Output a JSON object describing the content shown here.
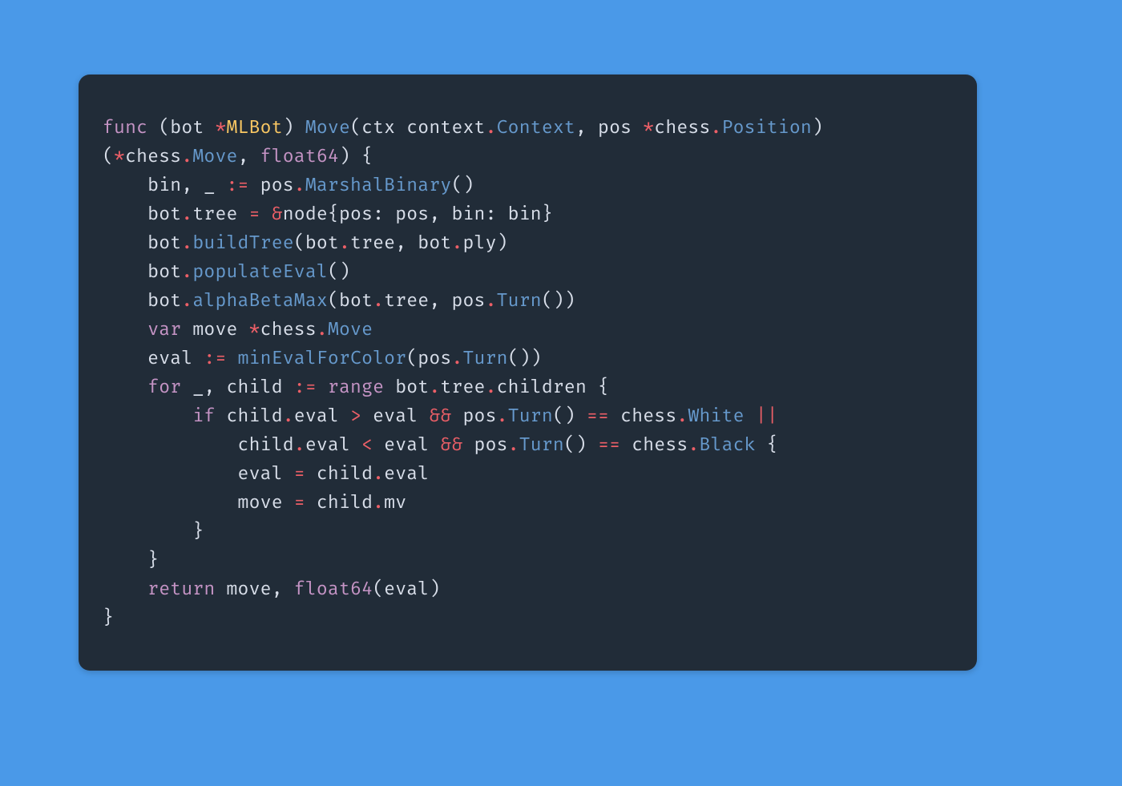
{
  "language": "go",
  "code": {
    "lines": [
      [
        {
          "t": "func",
          "c": "kw"
        },
        {
          "t": " (bot ",
          "c": "id"
        },
        {
          "t": "*",
          "c": "op"
        },
        {
          "t": "MLBot",
          "c": "ty"
        },
        {
          "t": ") ",
          "c": "id"
        },
        {
          "t": "Move",
          "c": "fn"
        },
        {
          "t": "(ctx context",
          "c": "id"
        },
        {
          "t": ".",
          "c": "op"
        },
        {
          "t": "Context",
          "c": "fn"
        },
        {
          "t": ", pos ",
          "c": "id"
        },
        {
          "t": "*",
          "c": "op"
        },
        {
          "t": "chess",
          "c": "id"
        },
        {
          "t": ".",
          "c": "op"
        },
        {
          "t": "Position",
          "c": "fn"
        },
        {
          "t": ") ",
          "c": "id"
        }
      ],
      [
        {
          "t": "(",
          "c": "id"
        },
        {
          "t": "*",
          "c": "op"
        },
        {
          "t": "chess",
          "c": "id"
        },
        {
          "t": ".",
          "c": "op"
        },
        {
          "t": "Move",
          "c": "fn"
        },
        {
          "t": ", ",
          "c": "id"
        },
        {
          "t": "float64",
          "c": "kw"
        },
        {
          "t": ") {",
          "c": "id"
        }
      ],
      [
        {
          "t": "    bin, _ ",
          "c": "id"
        },
        {
          "t": ":=",
          "c": "op"
        },
        {
          "t": " pos",
          "c": "id"
        },
        {
          "t": ".",
          "c": "op"
        },
        {
          "t": "MarshalBinary",
          "c": "fn"
        },
        {
          "t": "()",
          "c": "id"
        }
      ],
      [
        {
          "t": "    bot",
          "c": "id"
        },
        {
          "t": ".",
          "c": "op"
        },
        {
          "t": "tree ",
          "c": "id"
        },
        {
          "t": "=",
          "c": "op"
        },
        {
          "t": " ",
          "c": "id"
        },
        {
          "t": "&",
          "c": "am"
        },
        {
          "t": "node{pos: pos, bin: bin}",
          "c": "id"
        }
      ],
      [
        {
          "t": "    bot",
          "c": "id"
        },
        {
          "t": ".",
          "c": "op"
        },
        {
          "t": "buildTree",
          "c": "fn"
        },
        {
          "t": "(bot",
          "c": "id"
        },
        {
          "t": ".",
          "c": "op"
        },
        {
          "t": "tree, bot",
          "c": "id"
        },
        {
          "t": ".",
          "c": "op"
        },
        {
          "t": "ply)",
          "c": "id"
        }
      ],
      [
        {
          "t": "    bot",
          "c": "id"
        },
        {
          "t": ".",
          "c": "op"
        },
        {
          "t": "populateEval",
          "c": "fn"
        },
        {
          "t": "()",
          "c": "id"
        }
      ],
      [
        {
          "t": "    bot",
          "c": "id"
        },
        {
          "t": ".",
          "c": "op"
        },
        {
          "t": "alphaBetaMax",
          "c": "fn"
        },
        {
          "t": "(bot",
          "c": "id"
        },
        {
          "t": ".",
          "c": "op"
        },
        {
          "t": "tree, pos",
          "c": "id"
        },
        {
          "t": ".",
          "c": "op"
        },
        {
          "t": "Turn",
          "c": "fn"
        },
        {
          "t": "())",
          "c": "id"
        }
      ],
      [
        {
          "t": "    ",
          "c": "id"
        },
        {
          "t": "var",
          "c": "kw"
        },
        {
          "t": " move ",
          "c": "id"
        },
        {
          "t": "*",
          "c": "op"
        },
        {
          "t": "chess",
          "c": "id"
        },
        {
          "t": ".",
          "c": "op"
        },
        {
          "t": "Move",
          "c": "fn"
        }
      ],
      [
        {
          "t": "    eval ",
          "c": "id"
        },
        {
          "t": ":=",
          "c": "op"
        },
        {
          "t": " ",
          "c": "id"
        },
        {
          "t": "minEvalForColor",
          "c": "fn"
        },
        {
          "t": "(pos",
          "c": "id"
        },
        {
          "t": ".",
          "c": "op"
        },
        {
          "t": "Turn",
          "c": "fn"
        },
        {
          "t": "())",
          "c": "id"
        }
      ],
      [
        {
          "t": "    ",
          "c": "id"
        },
        {
          "t": "for",
          "c": "kw"
        },
        {
          "t": " _, child ",
          "c": "id"
        },
        {
          "t": ":=",
          "c": "op"
        },
        {
          "t": " ",
          "c": "id"
        },
        {
          "t": "range",
          "c": "kw"
        },
        {
          "t": " bot",
          "c": "id"
        },
        {
          "t": ".",
          "c": "op"
        },
        {
          "t": "tree",
          "c": "id"
        },
        {
          "t": ".",
          "c": "op"
        },
        {
          "t": "children {",
          "c": "id"
        }
      ],
      [
        {
          "t": "        ",
          "c": "id"
        },
        {
          "t": "if",
          "c": "kw"
        },
        {
          "t": " child",
          "c": "id"
        },
        {
          "t": ".",
          "c": "op"
        },
        {
          "t": "eval ",
          "c": "id"
        },
        {
          "t": ">",
          "c": "op"
        },
        {
          "t": " eval ",
          "c": "id"
        },
        {
          "t": "&&",
          "c": "op"
        },
        {
          "t": " pos",
          "c": "id"
        },
        {
          "t": ".",
          "c": "op"
        },
        {
          "t": "Turn",
          "c": "fn"
        },
        {
          "t": "() ",
          "c": "id"
        },
        {
          "t": "==",
          "c": "op"
        },
        {
          "t": " chess",
          "c": "id"
        },
        {
          "t": ".",
          "c": "op"
        },
        {
          "t": "White",
          "c": "fn"
        },
        {
          "t": " ",
          "c": "id"
        },
        {
          "t": "||",
          "c": "op"
        }
      ],
      [
        {
          "t": "            child",
          "c": "id"
        },
        {
          "t": ".",
          "c": "op"
        },
        {
          "t": "eval ",
          "c": "id"
        },
        {
          "t": "<",
          "c": "op"
        },
        {
          "t": " eval ",
          "c": "id"
        },
        {
          "t": "&&",
          "c": "op"
        },
        {
          "t": " pos",
          "c": "id"
        },
        {
          "t": ".",
          "c": "op"
        },
        {
          "t": "Turn",
          "c": "fn"
        },
        {
          "t": "() ",
          "c": "id"
        },
        {
          "t": "==",
          "c": "op"
        },
        {
          "t": " chess",
          "c": "id"
        },
        {
          "t": ".",
          "c": "op"
        },
        {
          "t": "Black",
          "c": "fn"
        },
        {
          "t": " {",
          "c": "id"
        }
      ],
      [
        {
          "t": "            eval ",
          "c": "id"
        },
        {
          "t": "=",
          "c": "op"
        },
        {
          "t": " child",
          "c": "id"
        },
        {
          "t": ".",
          "c": "op"
        },
        {
          "t": "eval",
          "c": "id"
        }
      ],
      [
        {
          "t": "            move ",
          "c": "id"
        },
        {
          "t": "=",
          "c": "op"
        },
        {
          "t": " child",
          "c": "id"
        },
        {
          "t": ".",
          "c": "op"
        },
        {
          "t": "mv",
          "c": "id"
        }
      ],
      [
        {
          "t": "        }",
          "c": "id"
        }
      ],
      [
        {
          "t": "    }",
          "c": "id"
        }
      ],
      [
        {
          "t": "    ",
          "c": "id"
        },
        {
          "t": "return",
          "c": "kw"
        },
        {
          "t": " move, ",
          "c": "id"
        },
        {
          "t": "float64",
          "c": "kw"
        },
        {
          "t": "(eval)",
          "c": "id"
        }
      ],
      [
        {
          "t": "}",
          "c": "id"
        }
      ]
    ]
  }
}
